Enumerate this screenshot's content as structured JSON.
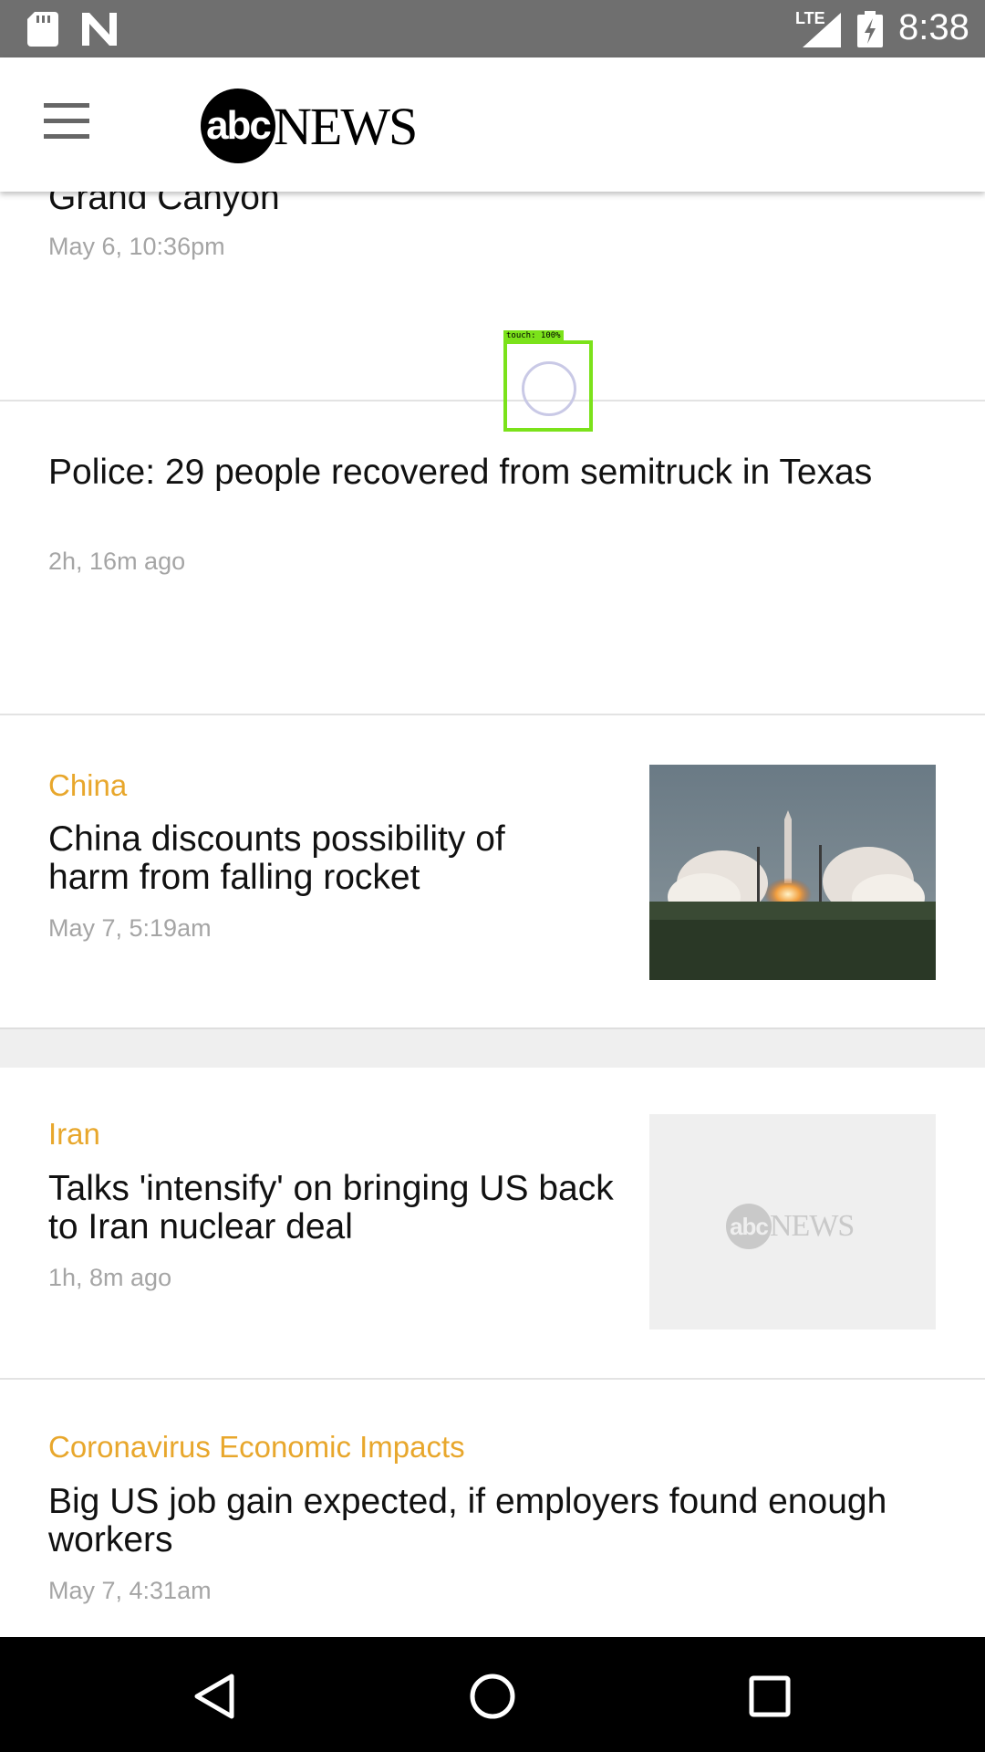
{
  "status_bar": {
    "network": "LTE",
    "time": "8:38",
    "icons": [
      "sd-card-icon",
      "n-notification-icon",
      "signal-icon",
      "battery-charging-icon"
    ]
  },
  "app_bar": {
    "logo_abc": "abc",
    "logo_news": "NEWS",
    "menu_icon": "hamburger-menu-icon"
  },
  "touch_indicator": {
    "label": "touch: 100%"
  },
  "feed": {
    "stories": [
      {
        "category": "",
        "headline": "Grand Canyon",
        "time": "May 6, 10:36pm"
      },
      {
        "category": "",
        "headline": "Police: 29 people recovered from semitruck in Texas",
        "time": "2h, 16m ago"
      },
      {
        "category": "China",
        "headline": "China discounts possibility of harm from falling rocket",
        "time": "May 7, 5:19am",
        "image": "rocket-launch-photo"
      },
      {
        "category": "Iran",
        "headline": "Talks 'intensify' on bringing US back to Iran nuclear deal",
        "time": "1h, 8m ago",
        "image": "abc-news-placeholder",
        "placeholder_abc": "abc",
        "placeholder_news": "NEWS"
      },
      {
        "category": "Coronavirus Economic Impacts",
        "headline": "Big US job gain expected, if employers found enough workers",
        "time": "May 7, 4:31am"
      }
    ]
  },
  "colors": {
    "category_accent": "#e8a72c",
    "status_bar": "#6f6f6f",
    "nav_bar": "#000000"
  },
  "nav_bar": {
    "buttons": [
      "back-icon",
      "home-icon",
      "recents-icon"
    ]
  }
}
